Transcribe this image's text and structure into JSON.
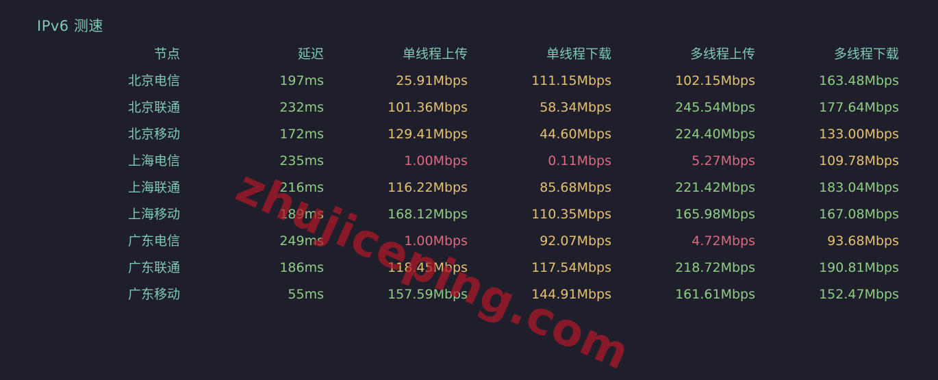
{
  "title": "IPv6 测速",
  "columns": [
    "节点",
    "延迟",
    "单线程上传",
    "单线程下载",
    "多线程上传",
    "多线程下载"
  ],
  "rows": [
    {
      "node": "北京电信",
      "latency": "197ms",
      "st_up": "25.91Mbps",
      "st_down": "111.15Mbps",
      "mt_up": "102.15Mbps",
      "mt_down": "163.48Mbps",
      "colors": {
        "latency": "green",
        "st_up": "yellow",
        "st_down": "yellow",
        "mt_up": "yellow",
        "mt_down": "green"
      }
    },
    {
      "node": "北京联通",
      "latency": "232ms",
      "st_up": "101.36Mbps",
      "st_down": "58.34Mbps",
      "mt_up": "245.54Mbps",
      "mt_down": "177.64Mbps",
      "colors": {
        "latency": "green",
        "st_up": "yellow",
        "st_down": "yellow",
        "mt_up": "green",
        "mt_down": "green"
      }
    },
    {
      "node": "北京移动",
      "latency": "172ms",
      "st_up": "129.41Mbps",
      "st_down": "44.60Mbps",
      "mt_up": "224.40Mbps",
      "mt_down": "133.00Mbps",
      "colors": {
        "latency": "green",
        "st_up": "yellow",
        "st_down": "yellow",
        "mt_up": "green",
        "mt_down": "yellow"
      }
    },
    {
      "node": "上海电信",
      "latency": "235ms",
      "st_up": "1.00Mbps",
      "st_down": "0.11Mbps",
      "mt_up": "5.27Mbps",
      "mt_down": "109.78Mbps",
      "colors": {
        "latency": "green",
        "st_up": "red",
        "st_down": "red",
        "mt_up": "red",
        "mt_down": "yellow"
      }
    },
    {
      "node": "上海联通",
      "latency": "216ms",
      "st_up": "116.22Mbps",
      "st_down": "85.68Mbps",
      "mt_up": "221.42Mbps",
      "mt_down": "183.04Mbps",
      "colors": {
        "latency": "green",
        "st_up": "yellow",
        "st_down": "yellow",
        "mt_up": "green",
        "mt_down": "green"
      }
    },
    {
      "node": "上海移动",
      "latency": "189ms",
      "st_up": "168.12Mbps",
      "st_down": "110.35Mbps",
      "mt_up": "165.98Mbps",
      "mt_down": "167.08Mbps",
      "colors": {
        "latency": "green",
        "st_up": "green",
        "st_down": "yellow",
        "mt_up": "green",
        "mt_down": "green"
      }
    },
    {
      "node": "广东电信",
      "latency": "249ms",
      "st_up": "1.00Mbps",
      "st_down": "92.07Mbps",
      "mt_up": "4.72Mbps",
      "mt_down": "93.68Mbps",
      "colors": {
        "latency": "green",
        "st_up": "red",
        "st_down": "yellow",
        "mt_up": "red",
        "mt_down": "yellow"
      }
    },
    {
      "node": "广东联通",
      "latency": "186ms",
      "st_up": "118.45Mbps",
      "st_down": "117.54Mbps",
      "mt_up": "218.72Mbps",
      "mt_down": "190.81Mbps",
      "colors": {
        "latency": "green",
        "st_up": "yellow",
        "st_down": "yellow",
        "mt_up": "green",
        "mt_down": "green"
      }
    },
    {
      "node": "广东移动",
      "latency": "55ms",
      "st_up": "157.59Mbps",
      "st_down": "144.91Mbps",
      "mt_up": "161.61Mbps",
      "mt_down": "152.47Mbps",
      "colors": {
        "latency": "green",
        "st_up": "green",
        "st_down": "yellow",
        "mt_up": "green",
        "mt_down": "green"
      }
    }
  ],
  "watermark": "zhujiceping.com",
  "palette": {
    "background": "#1f1e2b",
    "header": "#7fc9b4",
    "green": "#8fce85",
    "yellow": "#e4c274",
    "red": "#de6a7f",
    "watermark": "#b21828"
  }
}
